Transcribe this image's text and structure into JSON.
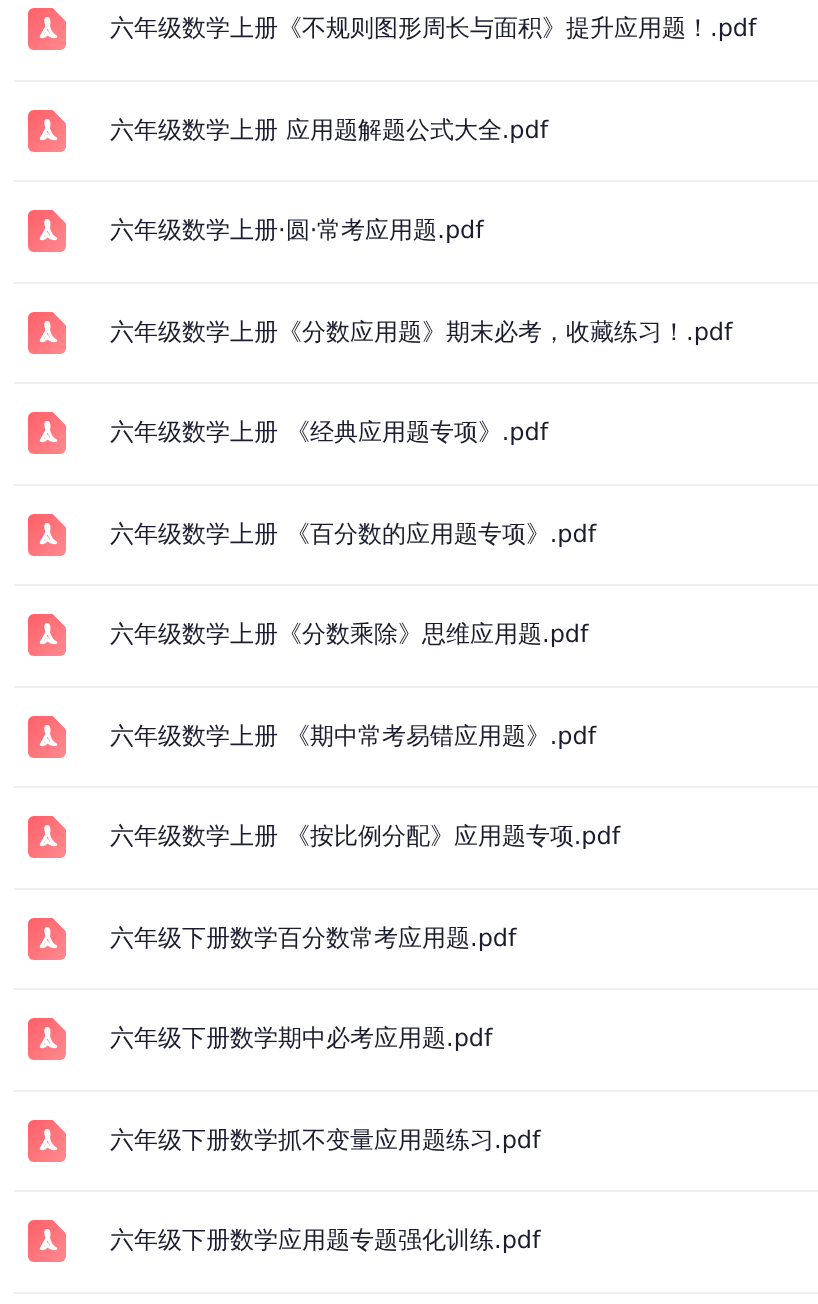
{
  "files": [
    {
      "name": "六年级数学上册《不规则图形周长与面积》提升应用题！.pdf"
    },
    {
      "name": "六年级数学上册 应用题解题公式大全.pdf"
    },
    {
      "name": "六年级数学上册·圆·常考应用题.pdf"
    },
    {
      "name": "六年级数学上册《分数应用题》期末必考，收藏练习！.pdf"
    },
    {
      "name": "六年级数学上册 《经典应用题专项》.pdf"
    },
    {
      "name": "六年级数学上册 《百分数的应用题专项》.pdf"
    },
    {
      "name": "六年级数学上册《分数乘除》思维应用题.pdf"
    },
    {
      "name": "六年级数学上册 《期中常考易错应用题》.pdf"
    },
    {
      "name": "六年级数学上册 《按比例分配》应用题专项.pdf"
    },
    {
      "name": "六年级下册数学百分数常考应用题.pdf"
    },
    {
      "name": "六年级下册数学期中必考应用题.pdf"
    },
    {
      "name": "六年级下册数学抓不变量应用题练习.pdf"
    },
    {
      "name": "六年级下册数学应用题专题强化训练.pdf"
    }
  ]
}
